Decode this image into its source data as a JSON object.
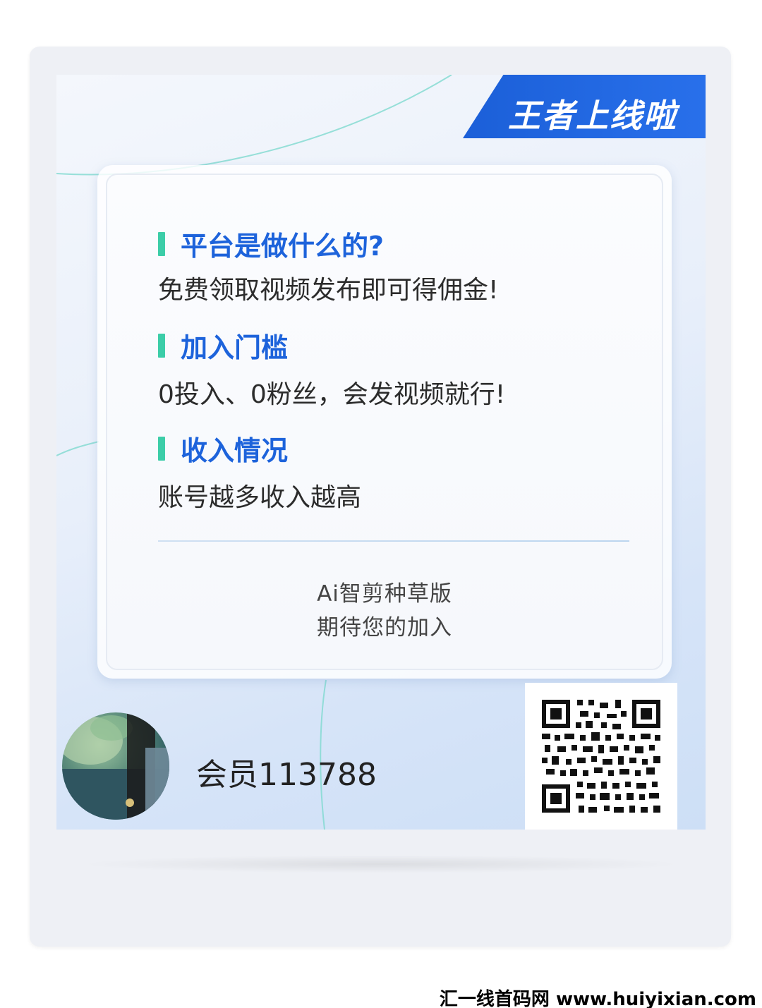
{
  "banner": {
    "title": "王者上线啦"
  },
  "sections": [
    {
      "heading": "平台是做什么的?",
      "body": "免费领取视频发布即可得佣金!"
    },
    {
      "heading": "加入门槛",
      "body": "0投入、0粉丝，会发视频就行!"
    },
    {
      "heading": "收入情况",
      "body": "账号越多收入越高"
    }
  ],
  "footer": {
    "line1": "Ai智剪种草版",
    "line2": "期待您的加入"
  },
  "member": {
    "name": "会员113788"
  },
  "watermark": {
    "text": "汇一线首码网 www.huiyixian.com"
  },
  "colors": {
    "accent_blue": "#1d63db",
    "accent_green": "#3ccda8",
    "banner_blue": "#1b5fd8"
  },
  "icons": {
    "avatar": "user-avatar-photo",
    "qr": "qr-code-icon"
  }
}
